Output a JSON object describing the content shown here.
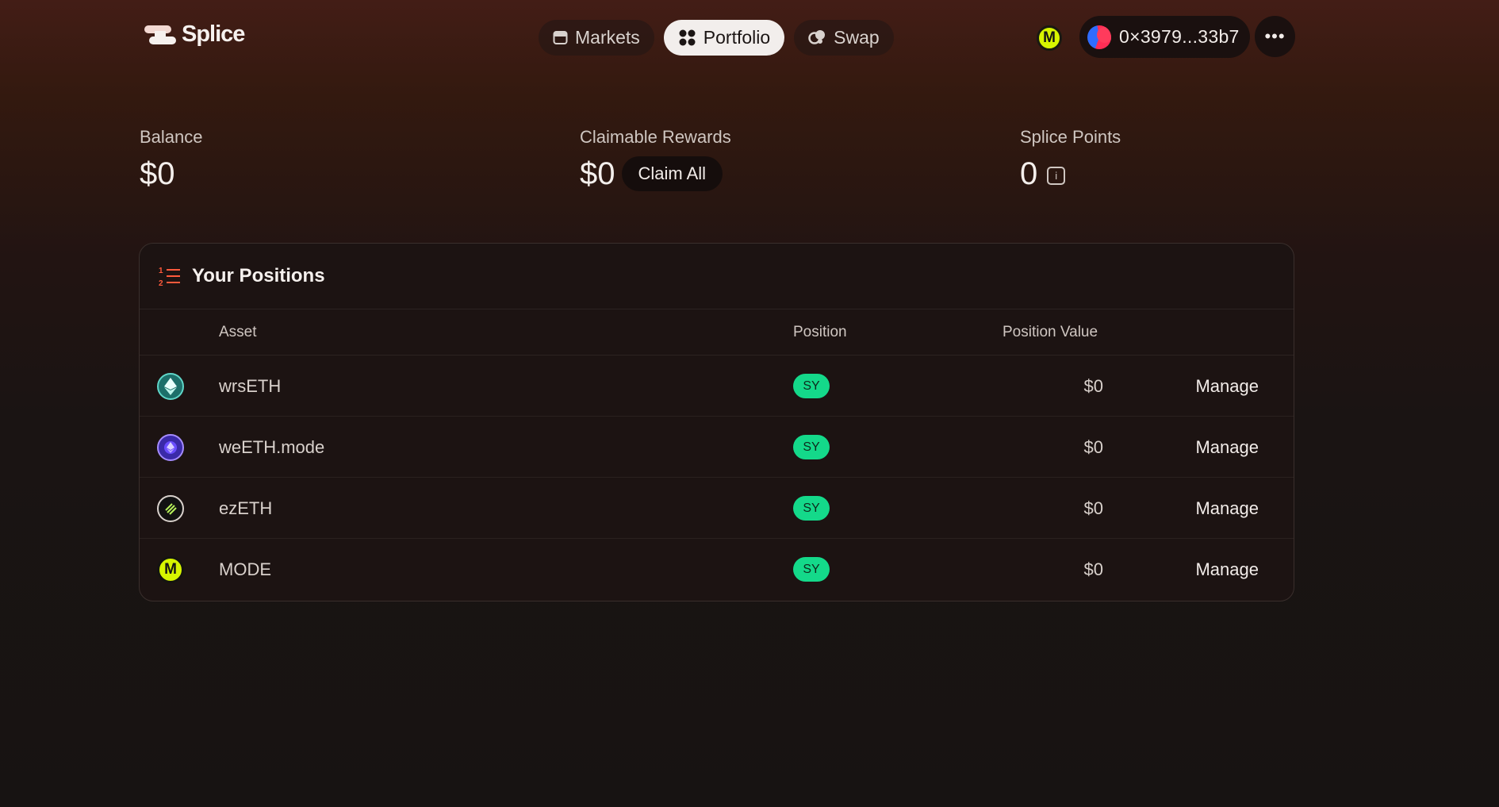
{
  "header": {
    "logo_text": "Splice",
    "nav": [
      {
        "label": "Markets",
        "icon": "store-icon"
      },
      {
        "label": "Portfolio",
        "icon": "grid-icon",
        "active": true
      },
      {
        "label": "Swap",
        "icon": "swap-icon"
      }
    ],
    "network_badge": "M",
    "wallet_address": "0×3979...33b7",
    "more_label": "•••"
  },
  "stats": {
    "balance": {
      "label": "Balance",
      "value": "$0"
    },
    "rewards": {
      "label": "Claimable Rewards",
      "value": "$0",
      "claim_label": "Claim All"
    },
    "points": {
      "label": "Splice Points",
      "value": "0",
      "info_icon": "i"
    }
  },
  "positions": {
    "title": "Your Positions",
    "columns": {
      "asset": "Asset",
      "position": "Position",
      "value": "Position Value"
    },
    "rows": [
      {
        "asset": "wrsETH",
        "position": "SY",
        "value": "$0",
        "action": "Manage",
        "icon": "eth-icon"
      },
      {
        "asset": "weETH.mode",
        "position": "SY",
        "value": "$0",
        "action": "Manage",
        "icon": "weeth-icon"
      },
      {
        "asset": "ezETH",
        "position": "SY",
        "value": "$0",
        "action": "Manage",
        "icon": "ezeth-icon"
      },
      {
        "asset": "MODE",
        "position": "SY",
        "value": "$0",
        "action": "Manage",
        "icon": "mode-icon",
        "badge_letter": "M"
      }
    ]
  },
  "colors": {
    "accent_green": "#14d98a",
    "mode_yellow": "#d7f500",
    "bg_dark": "#171312"
  }
}
